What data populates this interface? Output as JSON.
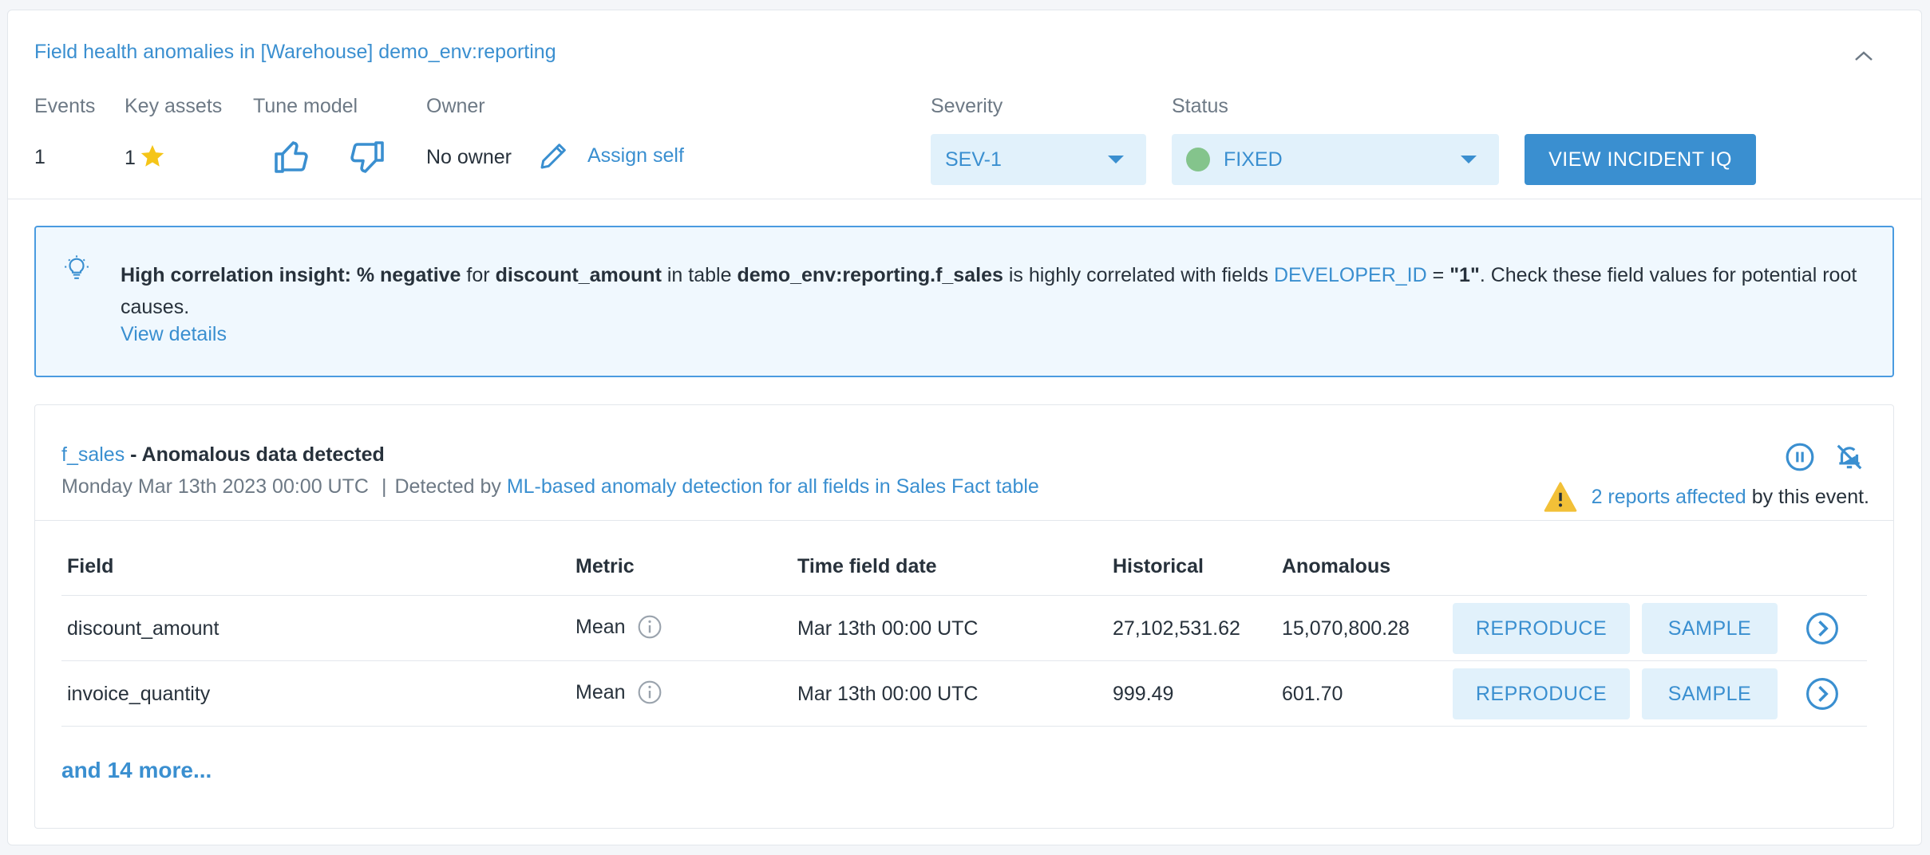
{
  "header": {
    "title": "Field health anomalies in [Warehouse] demo_env:reporting",
    "labels": {
      "events": "Events",
      "key_assets": "Key assets",
      "tune_model": "Tune model",
      "owner": "Owner",
      "severity": "Severity",
      "status": "Status"
    },
    "events_value": "1",
    "key_assets_value": "1",
    "owner_value": "No owner",
    "assign_self": "Assign self",
    "severity_value": "SEV-1",
    "status_value": "FIXED",
    "view_incident_label": "VIEW INCIDENT IQ"
  },
  "insight": {
    "prefix_bold": "High correlation insight:",
    "metric_bold": "% negative",
    "for_text": "for",
    "field_bold": "discount_amount",
    "in_table_text": "in table",
    "table_bold": "demo_env:reporting.f_sales",
    "correlated_text": "is highly correlated with fields",
    "field_link": "DEVELOPER_ID",
    "equals_text": "=",
    "value_bold": "\"1\"",
    "suffix_text": ". Check these field values for potential root causes.",
    "view_details": "View details"
  },
  "event": {
    "table_link": "f_sales",
    "title_rest": "- Anomalous data detected",
    "date": "Monday Mar 13th 2023 00:00 UTC",
    "separator": "|",
    "detected_by": "Detected by",
    "monitor_link": "ML-based anomaly detection for all fields in Sales Fact table",
    "reports_link": "2 reports affected",
    "reports_suffix": "by this event."
  },
  "table": {
    "headers": {
      "field": "Field",
      "metric": "Metric",
      "time_field_date": "Time field date",
      "historical": "Historical",
      "anomalous": "Anomalous"
    },
    "rows": [
      {
        "field": "discount_amount",
        "metric": "Mean",
        "time": "Mar 13th 00:00 UTC",
        "historical": "27,102,531.62",
        "anomalous": "15,070,800.28",
        "reproduce": "REPRODUCE",
        "sample": "SAMPLE"
      },
      {
        "field": "invoice_quantity",
        "metric": "Mean",
        "time": "Mar 13th 00:00 UTC",
        "historical": "999.49",
        "anomalous": "601.70",
        "reproduce": "REPRODUCE",
        "sample": "SAMPLE"
      }
    ],
    "more_link": "and 14 more..."
  },
  "colors": {
    "accent": "#3a8fd0",
    "accent_bg": "#e1f1fb",
    "status_fixed": "#84c48c",
    "star": "#f5c518",
    "warning": "#f2c037"
  },
  "icons": [
    "chevron-up-icon",
    "star-icon",
    "thumbs-up-icon",
    "thumbs-down-icon",
    "pencil-icon",
    "caret-down-icon",
    "lightbulb-icon",
    "pause-icon",
    "bell-off-icon",
    "warning-icon",
    "info-icon",
    "chevron-right-circle-icon"
  ]
}
